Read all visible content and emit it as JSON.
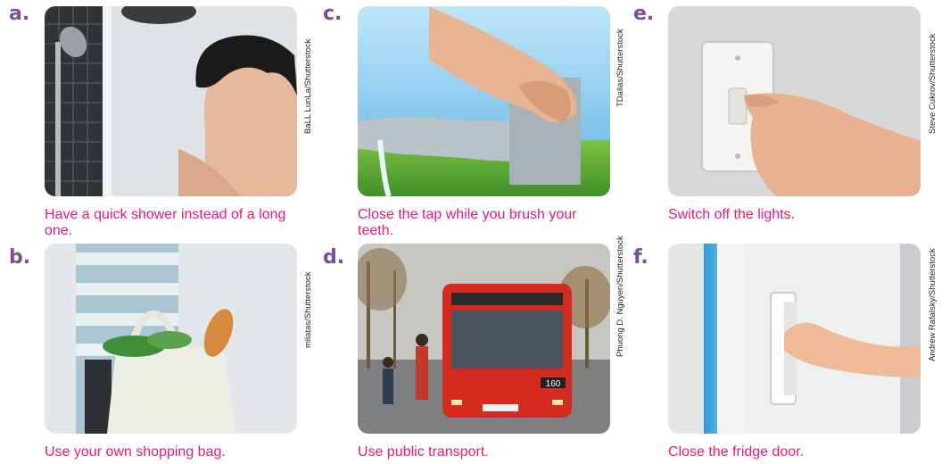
{
  "items": [
    {
      "letter": "a.",
      "caption": "Have a quick shower instead of a long one.",
      "credit": "BaLL LunLa/Shutterstock",
      "image": "man-showering"
    },
    {
      "letter": "b.",
      "caption": "Use your own shopping bag.",
      "credit": "milatas/Shutterstock",
      "image": "reusable-shopping-bag"
    },
    {
      "letter": "c.",
      "caption": "Close the tap while you brush your teeth.",
      "credit": "TDallas/Shutterstock",
      "image": "hand-closing-tap"
    },
    {
      "letter": "d.",
      "caption": "Use public transport.",
      "credit": "Phuong D. Nguyen/Shutterstock",
      "image": "red-city-bus"
    },
    {
      "letter": "e.",
      "caption": "Switch off the lights.",
      "credit": "Steve Cukrov/Shutterstock",
      "image": "finger-on-light-switch"
    },
    {
      "letter": "f.",
      "caption": "Close the fridge door.",
      "credit": "Andrew Rafalsky/Shutterstock",
      "image": "hand-closing-fridge-door"
    }
  ],
  "bus_route_number": "160",
  "colors": {
    "letter": "#7b4f97",
    "caption": "#e5197d"
  }
}
